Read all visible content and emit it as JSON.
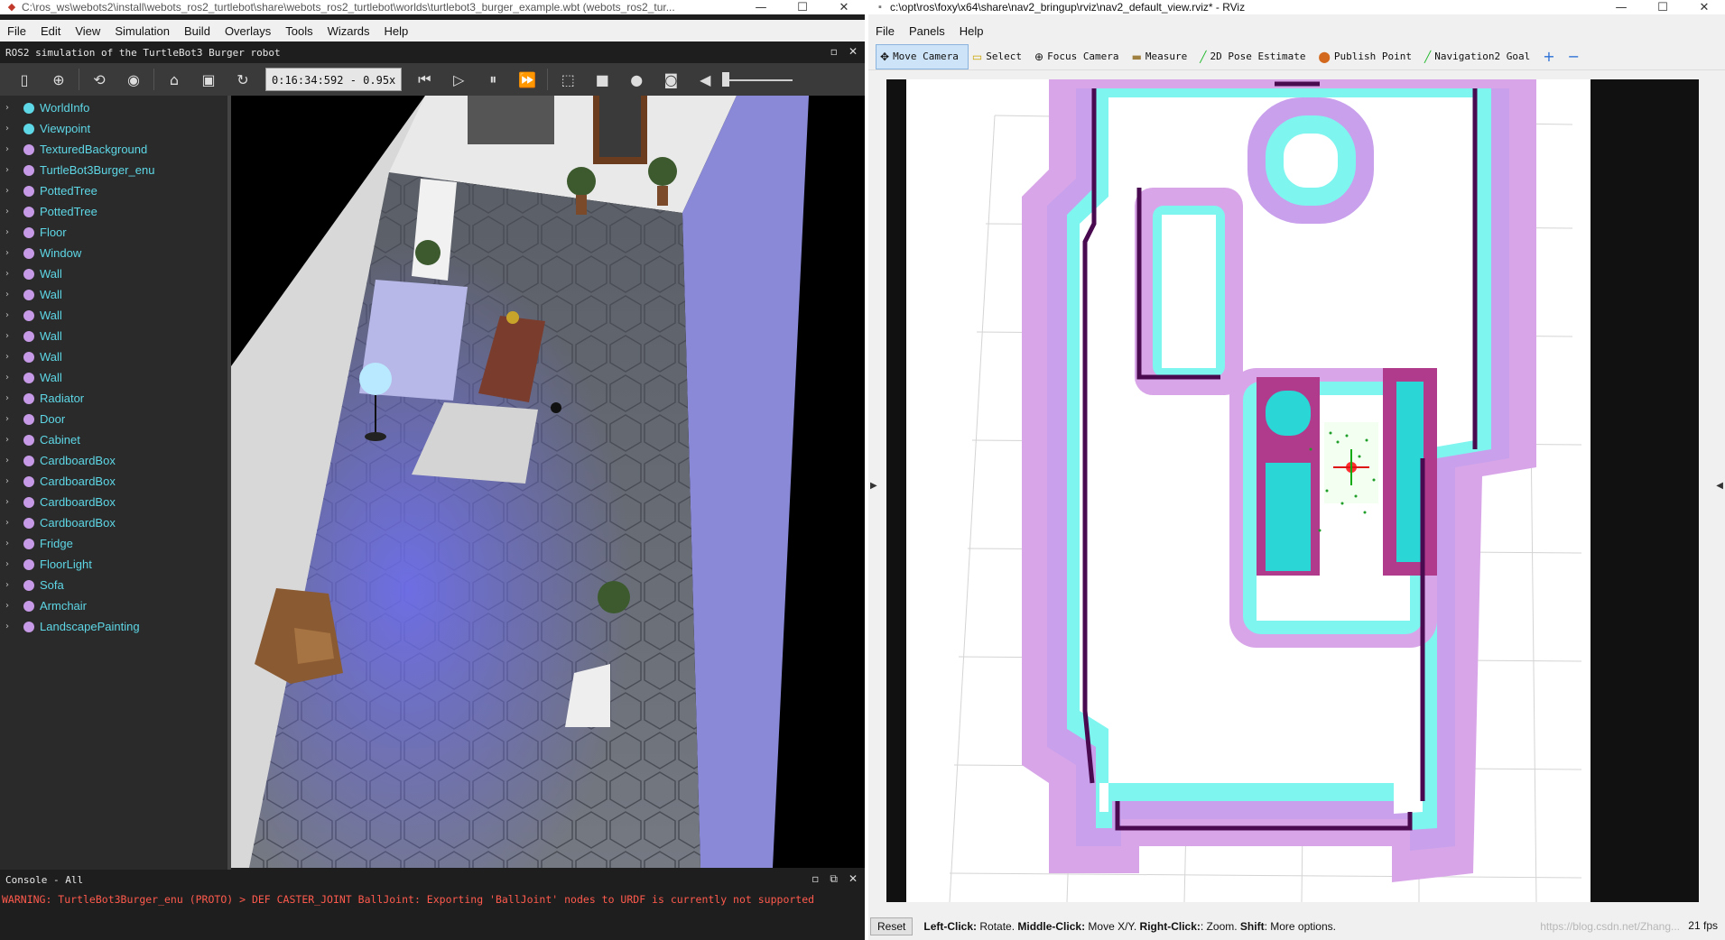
{
  "webots": {
    "title": "C:\\ros_ws\\webots2\\install\\webots_ros2_turtlebot\\share\\webots_ros2_turtlebot\\worlds\\turtlebot3_burger_example.wbt (webots_ros2_tur...",
    "menu": [
      "File",
      "Edit",
      "View",
      "Simulation",
      "Build",
      "Overlays",
      "Tools",
      "Wizards",
      "Help"
    ],
    "panel_title": "ROS2 simulation of the TurtleBot3 Burger robot",
    "clock": "0:16:34:592 - 0.95x",
    "scene_nodes": [
      {
        "label": "WorldInfo",
        "color": "#5ed7e6"
      },
      {
        "label": "Viewpoint",
        "color": "#5ed7e6"
      },
      {
        "label": "TexturedBackground",
        "color": "#c69ae6"
      },
      {
        "label": "TurtleBot3Burger_enu",
        "color": "#c69ae6"
      },
      {
        "label": "PottedTree",
        "color": "#c69ae6"
      },
      {
        "label": "PottedTree",
        "color": "#c69ae6"
      },
      {
        "label": "Floor",
        "color": "#c69ae6"
      },
      {
        "label": "Window",
        "color": "#c69ae6"
      },
      {
        "label": "Wall",
        "color": "#c69ae6"
      },
      {
        "label": "Wall",
        "color": "#c69ae6"
      },
      {
        "label": "Wall",
        "color": "#c69ae6"
      },
      {
        "label": "Wall",
        "color": "#c69ae6"
      },
      {
        "label": "Wall",
        "color": "#c69ae6"
      },
      {
        "label": "Wall",
        "color": "#c69ae6"
      },
      {
        "label": "Radiator",
        "color": "#c69ae6"
      },
      {
        "label": "Door",
        "color": "#c69ae6"
      },
      {
        "label": "Cabinet",
        "color": "#c69ae6"
      },
      {
        "label": "CardboardBox",
        "color": "#c69ae6"
      },
      {
        "label": "CardboardBox",
        "color": "#c69ae6"
      },
      {
        "label": "CardboardBox",
        "color": "#c69ae6"
      },
      {
        "label": "CardboardBox",
        "color": "#c69ae6"
      },
      {
        "label": "Fridge",
        "color": "#c69ae6"
      },
      {
        "label": "FloorLight",
        "color": "#c69ae6"
      },
      {
        "label": "Sofa",
        "color": "#c69ae6"
      },
      {
        "label": "Armchair",
        "color": "#c69ae6"
      },
      {
        "label": "LandscapePainting",
        "color": "#c69ae6"
      }
    ],
    "console_title": "Console - All",
    "console_message": "WARNING: TurtleBot3Burger_enu (PROTO) > DEF CASTER_JOINT BallJoint: Exporting 'BallJoint' nodes to URDF is currently not supported"
  },
  "rviz": {
    "title": "c:\\opt\\ros\\foxy\\x64\\share\\nav2_bringup\\rviz\\nav2_default_view.rviz* - RViz",
    "menu": [
      "File",
      "Panels",
      "Help"
    ],
    "tools": [
      {
        "label": "Move Camera",
        "icon": "move-camera-icon",
        "active": true
      },
      {
        "label": "Select",
        "icon": "select-icon",
        "active": false
      },
      {
        "label": "Focus Camera",
        "icon": "focus-camera-icon",
        "active": false
      },
      {
        "label": "Measure",
        "icon": "measure-icon",
        "active": false
      },
      {
        "label": "2D Pose Estimate",
        "icon": "pose-estimate-icon",
        "active": false
      },
      {
        "label": "Publish Point",
        "icon": "publish-point-icon",
        "active": false
      },
      {
        "label": "Navigation2 Goal",
        "icon": "nav-goal-icon",
        "active": false
      }
    ],
    "reset_label": "Reset",
    "hint_parts": [
      {
        "b": "Left-Click:",
        "t": " Rotate. "
      },
      {
        "b": "Middle-Click:",
        "t": " Move X/Y. "
      },
      {
        "b": "Right-Click:",
        "t": ": Zoom. "
      },
      {
        "b": "Shift",
        "t": ": More options."
      }
    ],
    "fps": "21 fps",
    "watermark": "https://blog.csdn.net/Zhang..."
  }
}
